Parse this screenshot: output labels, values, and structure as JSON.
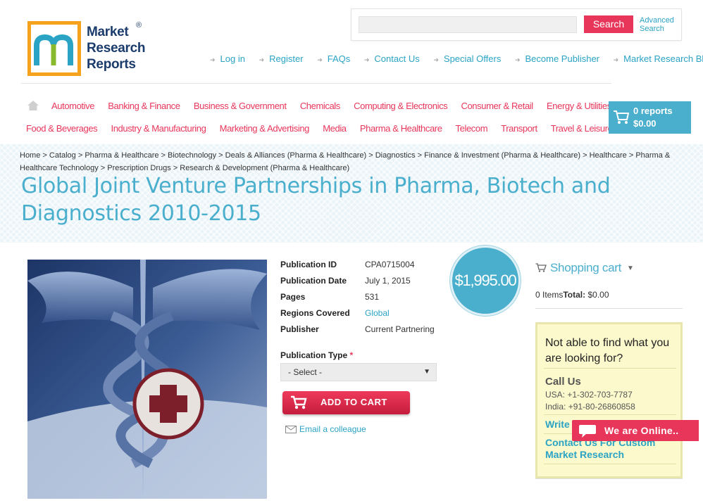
{
  "logo": {
    "line1": "Market",
    "line2": "Research",
    "line3": "Reports",
    "reg": "®"
  },
  "search": {
    "button": "Search",
    "advanced_line1": "Advanced",
    "advanced_line2": "Search",
    "placeholder": ""
  },
  "top_links": [
    "Log in",
    "Register",
    "FAQs",
    "Contact Us",
    "Special Offers",
    "Become Publisher",
    "Market Research Blog"
  ],
  "categories_row1": [
    "Automotive",
    "Banking & Finance",
    "Business & Government",
    "Chemicals",
    "Computing & Electronics",
    "Consumer & Retail",
    "Energy & Utilities"
  ],
  "categories_row2": [
    "Food & Beverages",
    "Industry & Manufacturing",
    "Marketing & Advertising",
    "Media",
    "Pharma & Healthcare",
    "Telecom",
    "Transport",
    "Travel & Leisure"
  ],
  "header_cart": {
    "count": "0 reports",
    "total": "$0.00"
  },
  "breadcrumb": "Home > Catalog > Pharma & Healthcare > Biotechnology > Deals & Alliances (Pharma & Healthcare) > Diagnostics > Finance & Investment (Pharma & Healthcare) > Healthcare > Pharma & Healthcare Technology > Prescription Drugs > Research & Development (Pharma & Healthcare)",
  "title": "Global Joint Venture Partnerships in Pharma, Biotech and Diagnostics 2010-2015",
  "details": [
    {
      "label": "Publication ID",
      "value": "CPA0715004"
    },
    {
      "label": "Publication Date",
      "value": "July 1, 2015"
    },
    {
      "label": "Pages",
      "value": "531"
    },
    {
      "label": "Regions Covered",
      "value": "Global"
    },
    {
      "label": "Publisher",
      "value": "Current Partnering"
    }
  ],
  "price": "$1,995.00",
  "publication_type": {
    "label": "Publication Type",
    "required": "*",
    "selected": "- Select -"
  },
  "add_to_cart": "ADD TO CART",
  "email_colleague": "Email a colleague",
  "sidebar": {
    "cart_title": "Shopping cart",
    "items_label": "0 Items",
    "total_label": "Total:",
    "total_value": "$0.00",
    "help_question": "Not able to find what you are looking for?",
    "call_us": "Call Us",
    "phone_usa": "USA: +1-302-703-7787",
    "phone_india": "India: +91-80-26860858",
    "write_to_us": "Write to Us",
    "custom_research": "Contact Us For Custom Market Research"
  },
  "chat": {
    "label": "We are Online.."
  },
  "colors": {
    "accent": "#4aaecd",
    "brand_pink": "#e8365a",
    "logo_orange": "#f6a21d",
    "logo_navy": "#1a3b6b"
  }
}
